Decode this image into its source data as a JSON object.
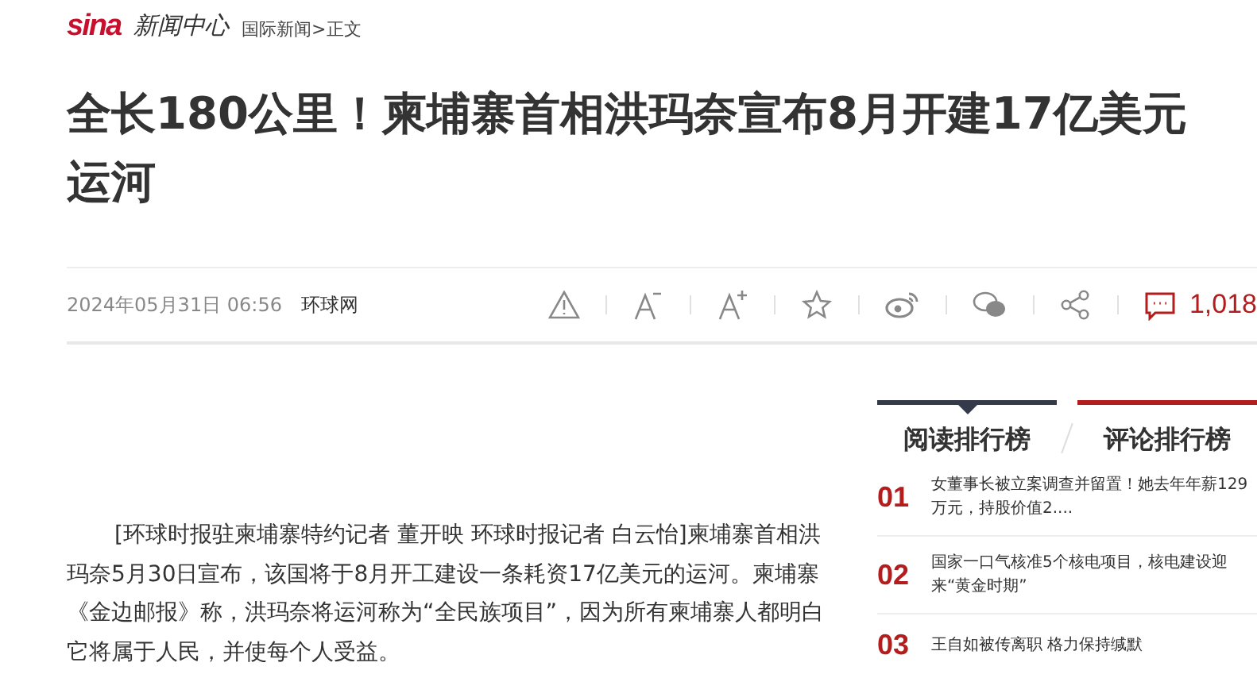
{
  "header": {
    "logo": "sina",
    "channel": "新闻中心",
    "breadcrumb": [
      {
        "label": "国际新闻"
      },
      {
        "label": "正文"
      }
    ],
    "separator": ">"
  },
  "article": {
    "title": "全长180公里！柬埔寨首相洪玛奈宣布8月开建17亿美元运河",
    "date": "2024年05月31日 06:56",
    "source": "环球网",
    "comment_count": "1,018",
    "paragraph": "[环球时报驻柬埔寨特约记者 董开映 环球时报记者 白云怡]柬埔寨首相洪玛奈5月30日宣布，该国将于8月开工建设一条耗资17亿美元的运河。柬埔寨《金边邮报》称，洪玛奈将运河称为“全民族项目”，因为所有柬埔寨人都明白它将属于人民，并使每个人受益。"
  },
  "toolbar": [
    {
      "kind": "report"
    },
    {
      "kind": "font-smaller"
    },
    {
      "kind": "font-larger"
    },
    {
      "kind": "favorite"
    },
    {
      "kind": "weibo"
    },
    {
      "kind": "wechat"
    },
    {
      "kind": "share"
    }
  ],
  "ranking": {
    "tabs": [
      {
        "label": "阅读排行榜",
        "selected": true
      },
      {
        "label": "评论排行榜",
        "selected": false
      }
    ],
    "items": [
      {
        "rank": "01",
        "text": "女董事长被立案调查并留置！她去年年薪129万元，持股价值2...."
      },
      {
        "rank": "02",
        "text": "国家一口气核准5个核电项目，核电建设迎来“黄金时期”"
      },
      {
        "rank": "03",
        "text": "王自如被传离职 格力保持缄默"
      }
    ]
  }
}
